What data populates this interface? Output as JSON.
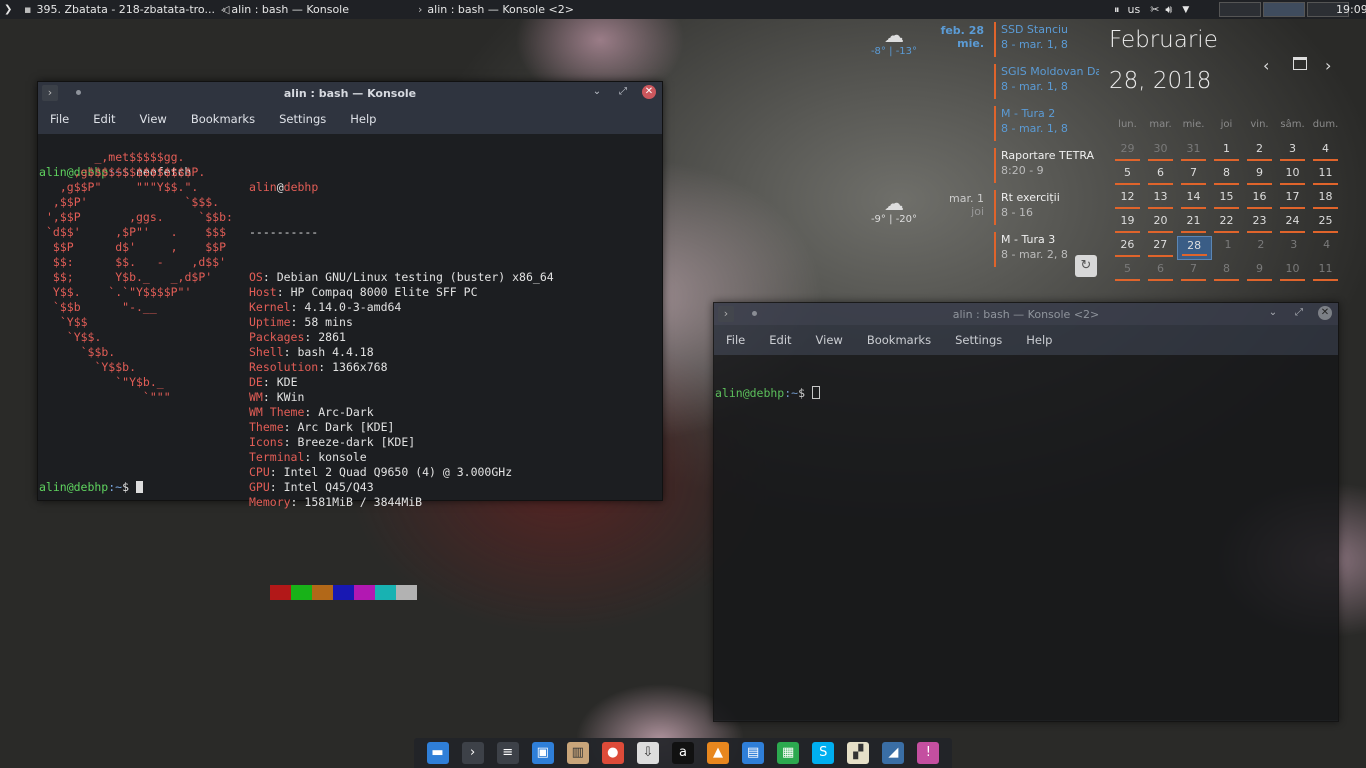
{
  "top_panel": {
    "app_launcher_icon": "chevron-right-icon",
    "tasks": [
      {
        "label": "395. Zbatata - 218-zbatata-tro..."
      },
      {
        "label": "alin : bash — Konsole"
      },
      {
        "label": "alin : bash — Konsole <2>"
      }
    ],
    "keyboard_layout": "us",
    "clock": "19:09"
  },
  "weather": [
    {
      "hi": "-8°",
      "lo": "-13°"
    },
    {
      "hi": "-9°",
      "lo": "-20°"
    }
  ],
  "dates": [
    {
      "date": "feb. 28",
      "day": "mie."
    },
    {
      "date": "mar. 1",
      "day": "joi"
    }
  ],
  "events": [
    {
      "title": "SSD Stanciu",
      "time": "8 - mar. 1, 8",
      "style": "blue"
    },
    {
      "title": "SGIS Moldovan Dan",
      "time": "8 - mar. 1, 8",
      "style": "blue"
    },
    {
      "title": "M - Tura 2",
      "time": "8 - mar. 1, 8",
      "style": "blue"
    },
    {
      "title": "Raportare TETRA",
      "time": "8:20 - 9",
      "style": "white"
    },
    {
      "title": "Rt exerciții",
      "time": "8 - 16",
      "style": "white"
    },
    {
      "title": "M - Tura 3",
      "time": "8 - mar. 2, 8",
      "style": "white"
    }
  ],
  "calendar": {
    "month": "Februarie",
    "date": "28, 2018",
    "weekdays": [
      "lun.",
      "mar.",
      "mie.",
      "joi",
      "vin.",
      "sâm.",
      "dum."
    ],
    "weeks": [
      [
        {
          "d": "29",
          "dim": true,
          "ev": true
        },
        {
          "d": "30",
          "dim": true,
          "ev": true
        },
        {
          "d": "31",
          "dim": true,
          "ev": true
        },
        {
          "d": "1",
          "ev": true
        },
        {
          "d": "2",
          "ev": true
        },
        {
          "d": "3",
          "ev": true
        },
        {
          "d": "4",
          "ev": true
        }
      ],
      [
        {
          "d": "5",
          "ev": true
        },
        {
          "d": "6",
          "ev": true
        },
        {
          "d": "7",
          "ev": true
        },
        {
          "d": "8",
          "ev": true
        },
        {
          "d": "9",
          "ev": true
        },
        {
          "d": "10",
          "ev": true
        },
        {
          "d": "11",
          "ev": true
        }
      ],
      [
        {
          "d": "12",
          "ev": true
        },
        {
          "d": "13",
          "ev": true
        },
        {
          "d": "14",
          "ev": true
        },
        {
          "d": "15",
          "ev": true
        },
        {
          "d": "16",
          "ev": true
        },
        {
          "d": "17",
          "ev": true
        },
        {
          "d": "18",
          "ev": true
        }
      ],
      [
        {
          "d": "19",
          "ev": true
        },
        {
          "d": "20",
          "ev": true
        },
        {
          "d": "21",
          "ev": true
        },
        {
          "d": "22",
          "ev": true
        },
        {
          "d": "23",
          "ev": true
        },
        {
          "d": "24",
          "ev": true
        },
        {
          "d": "25",
          "ev": true
        }
      ],
      [
        {
          "d": "26",
          "ev": true
        },
        {
          "d": "27",
          "ev": true
        },
        {
          "d": "28",
          "today": true,
          "ev": true
        },
        {
          "d": "1",
          "dim": true
        },
        {
          "d": "2",
          "dim": true
        },
        {
          "d": "3",
          "dim": true
        },
        {
          "d": "4",
          "dim": true
        }
      ],
      [
        {
          "d": "5",
          "dim": true,
          "ev": true
        },
        {
          "d": "6",
          "dim": true,
          "ev": true
        },
        {
          "d": "7",
          "dim": true,
          "ev": true
        },
        {
          "d": "8",
          "dim": true,
          "ev": true
        },
        {
          "d": "9",
          "dim": true,
          "ev": true
        },
        {
          "d": "10",
          "dim": true,
          "ev": true
        },
        {
          "d": "11",
          "dim": true,
          "ev": true
        }
      ]
    ]
  },
  "window1": {
    "title": "alin : bash — Konsole",
    "menu": [
      "File",
      "Edit",
      "View",
      "Bookmarks",
      "Settings",
      "Help"
    ],
    "prompt_user": "alin@debhp",
    "prompt_path": ":~",
    "prompt_sign": "$ ",
    "command": "neofetch",
    "logo": [
      "       _,met$$$$$gg.",
      "    ,g$$$$$$$$$$$$$$$P.",
      "  ,g$$P\"     \"\"\"Y$$.\".",
      " ,$$P'              `$$$.",
      "',$$P       ,ggs.     `$$b:",
      "`d$$'     ,$P\"'   .    $$$",
      " $$P      d$'     ,    $$P",
      " $$:      $$.   -    ,d$$'",
      " $$;      Y$b._   _,d$P'",
      " Y$$.    `.`\"Y$$$$P\"'",
      " `$$b      \"-.__",
      "  `Y$$",
      "   `Y$$.",
      "     `$$b.",
      "       `Y$$b.",
      "          `\"Y$b._",
      "              `\"\"\""
    ],
    "info_user": "alin",
    "info_at": "@",
    "info_host": "debhp",
    "info_sep": "----------",
    "info": [
      {
        "k": "OS",
        "v": "Debian GNU/Linux testing (buster) x86_64"
      },
      {
        "k": "Host",
        "v": "HP Compaq 8000 Elite SFF PC"
      },
      {
        "k": "Kernel",
        "v": "4.14.0-3-amd64"
      },
      {
        "k": "Uptime",
        "v": "58 mins"
      },
      {
        "k": "Packages",
        "v": "2861"
      },
      {
        "k": "Shell",
        "v": "bash 4.4.18"
      },
      {
        "k": "Resolution",
        "v": "1366x768"
      },
      {
        "k": "DE",
        "v": "KDE"
      },
      {
        "k": "WM",
        "v": "KWin"
      },
      {
        "k": "WM Theme",
        "v": "Arc-Dark"
      },
      {
        "k": "Theme",
        "v": "Arc Dark [KDE]"
      },
      {
        "k": "Icons",
        "v": "Breeze-dark [KDE]"
      },
      {
        "k": "Terminal",
        "v": "konsole"
      },
      {
        "k": "CPU",
        "v": "Intel 2 Quad Q9650 (4) @ 3.000GHz"
      },
      {
        "k": "GPU",
        "v": "Intel Q45/Q43"
      },
      {
        "k": "Memory",
        "v": "1581MiB / 3844MiB"
      }
    ],
    "palette": [
      "#b21818",
      "#18b218",
      "#b26818",
      "#1818b2",
      "#b218b2",
      "#18b2b2",
      "#b2b2b2"
    ]
  },
  "window2": {
    "title": "alin : bash — Konsole <2>",
    "menu": [
      "File",
      "Edit",
      "View",
      "Bookmarks",
      "Settings",
      "Help"
    ],
    "prompt_user": "alin@debhp",
    "prompt_path": ":~",
    "prompt_sign": "$ "
  },
  "dock": [
    {
      "name": "folder-icon",
      "color": "#2f7fd8",
      "glyph": "▬"
    },
    {
      "name": "terminal-icon",
      "color": "#3d4148",
      "glyph": "›"
    },
    {
      "name": "settings-panel-icon",
      "color": "#3d4148",
      "glyph": "≡"
    },
    {
      "name": "store-icon",
      "color": "#2f7fd8",
      "glyph": "▣"
    },
    {
      "name": "archive-icon",
      "color": "#c9a57a",
      "glyph": "▥"
    },
    {
      "name": "chrome-icon",
      "color": "#dd4b39",
      "glyph": "●"
    },
    {
      "name": "download-icon",
      "color": "#ddd",
      "glyph": "⇩"
    },
    {
      "name": "amarok-icon",
      "color": "#111",
      "glyph": "a"
    },
    {
      "name": "vlc-icon",
      "color": "#e8871e",
      "glyph": "▲"
    },
    {
      "name": "document-icon",
      "color": "#2f7fd8",
      "glyph": "▤"
    },
    {
      "name": "spreadsheet-icon",
      "color": "#2ca94f",
      "glyph": "▦"
    },
    {
      "name": "skype-icon",
      "color": "#00aff0",
      "glyph": "S"
    },
    {
      "name": "clapper-icon",
      "color": "#e6e0c8",
      "glyph": "▞"
    },
    {
      "name": "wireshark-icon",
      "color": "#3a6ea5",
      "glyph": "◢"
    },
    {
      "name": "podcast-icon",
      "color": "#c44fa0",
      "glyph": "!"
    }
  ]
}
